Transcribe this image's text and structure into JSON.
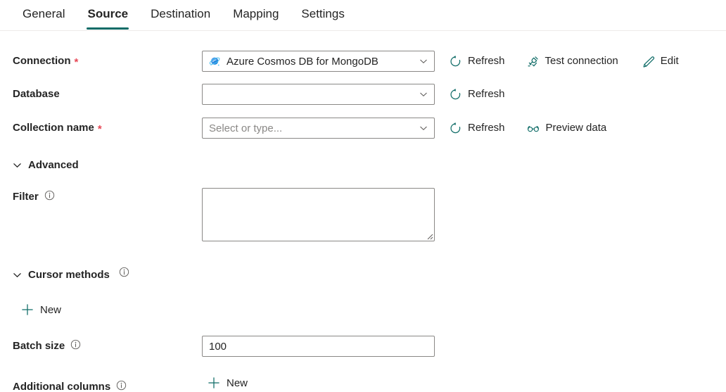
{
  "tabs": [
    {
      "label": "General",
      "active": false
    },
    {
      "label": "Source",
      "active": true
    },
    {
      "label": "Destination",
      "active": false
    },
    {
      "label": "Mapping",
      "active": false
    },
    {
      "label": "Settings",
      "active": false
    }
  ],
  "form": {
    "connection": {
      "label": "Connection",
      "required_marker": "*",
      "value": "Azure Cosmos DB for MongoDB",
      "icon": "azure-cosmos-db-icon",
      "actions": {
        "refresh": "Refresh",
        "test_connection": "Test connection",
        "edit": "Edit"
      }
    },
    "database": {
      "label": "Database",
      "value": "",
      "placeholder": "",
      "actions": {
        "refresh": "Refresh"
      }
    },
    "collection": {
      "label": "Collection name",
      "required_marker": "*",
      "value": "",
      "placeholder": "Select or type...",
      "actions": {
        "refresh": "Refresh",
        "preview_data": "Preview data"
      }
    },
    "advanced": {
      "label": "Advanced",
      "expanded": true
    },
    "filter": {
      "label": "Filter",
      "value": ""
    },
    "cursor_methods": {
      "label": "Cursor methods",
      "expanded": true,
      "new_label": "New"
    },
    "batch_size": {
      "label": "Batch size",
      "value": "100"
    },
    "additional_columns": {
      "label": "Additional columns",
      "new_label": "New"
    }
  },
  "colors": {
    "accent_teal": "#0f6c67",
    "required_red": "#e74856",
    "border_gray": "#8a8886",
    "text": "#242424",
    "placeholder": "#8a8886",
    "divider": "#edebe9",
    "cosmos_blue": "#1b9bed"
  }
}
